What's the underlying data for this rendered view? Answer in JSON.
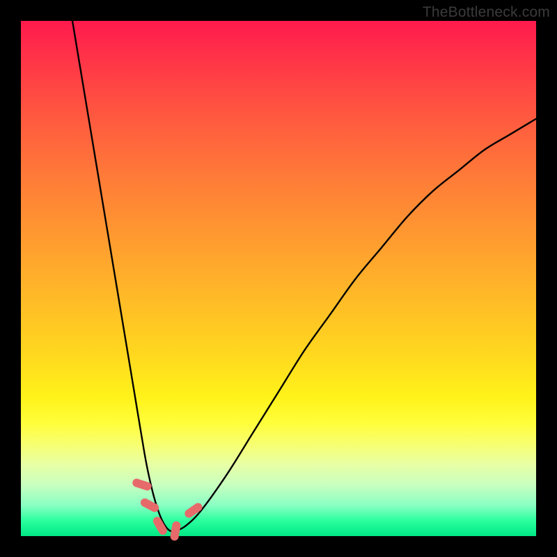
{
  "watermark": "TheBottleneck.com",
  "chart_data": {
    "type": "line",
    "title": "",
    "xlabel": "",
    "ylabel": "",
    "xlim": [
      0,
      100
    ],
    "ylim": [
      0,
      100
    ],
    "grid": false,
    "series": [
      {
        "name": "curve",
        "x": [
          10,
          12,
          14,
          16,
          18,
          20,
          22,
          24,
          25,
          26,
          27,
          28,
          29,
          30,
          32,
          35,
          40,
          45,
          50,
          55,
          60,
          65,
          70,
          75,
          80,
          85,
          90,
          95,
          100
        ],
        "y": [
          100,
          88,
          76,
          64,
          52,
          40,
          28,
          16,
          11,
          7,
          4,
          2,
          1,
          1,
          2,
          5,
          12,
          20,
          28,
          36,
          43,
          50,
          56,
          62,
          67,
          71,
          75,
          78,
          81
        ]
      }
    ],
    "markers": [
      {
        "x": 23.5,
        "y": 10,
        "angle": -72
      },
      {
        "x": 25.0,
        "y": 6,
        "angle": -62
      },
      {
        "x": 27.0,
        "y": 2,
        "angle": -30
      },
      {
        "x": 30.0,
        "y": 1,
        "angle": 10
      },
      {
        "x": 33.5,
        "y": 5,
        "angle": 55
      }
    ]
  }
}
